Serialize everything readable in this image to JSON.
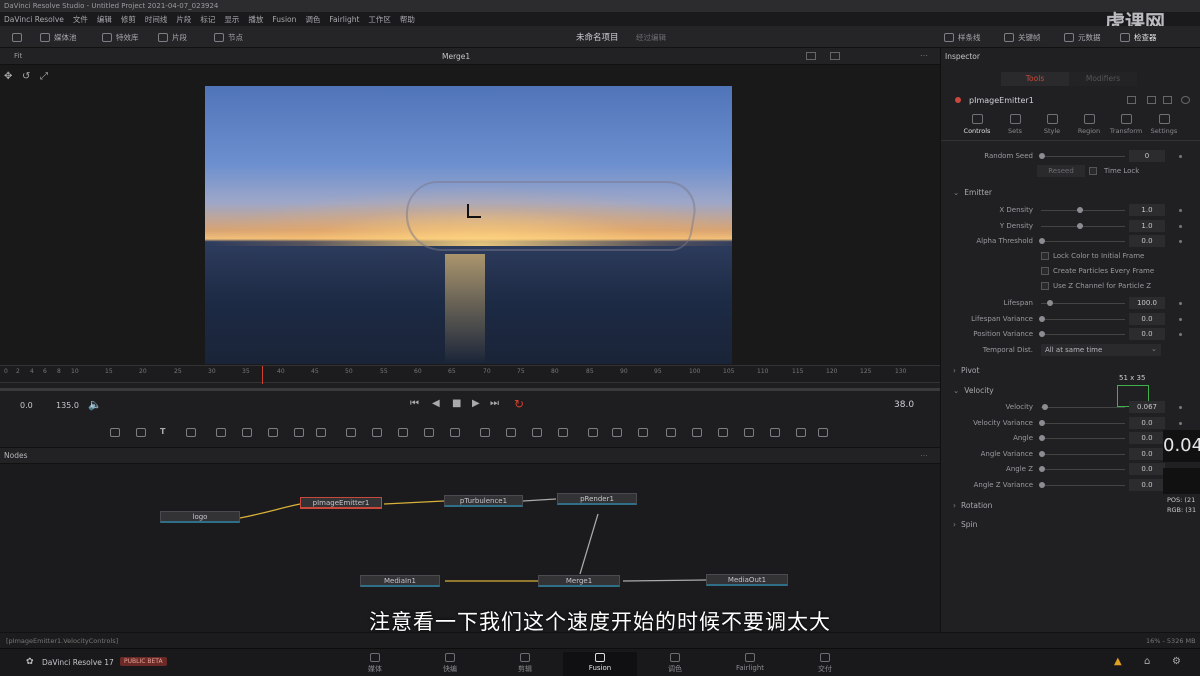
{
  "window_title": "DaVinci Resolve Studio - Untitled Project 2021-04-07_023924",
  "watermark": "虎课网",
  "menu": [
    "DaVinci Resolve",
    "文件",
    "编辑",
    "修剪",
    "时间线",
    "片段",
    "标记",
    "显示",
    "播放",
    "Fusion",
    "调色",
    "Fairlight",
    "工作区",
    "帮助"
  ],
  "toolbar": {
    "media_pool": "媒体池",
    "effects": "特效库",
    "clips": "片段",
    "nodes": "节点",
    "project_name": "未命名项目",
    "edited": "经过编辑",
    "spline": "样条线",
    "keyframes": "关键帧",
    "metadata": "元数据",
    "inspector": "检查器"
  },
  "viewer": {
    "title": "Merge1",
    "fit": "Fit"
  },
  "timeline": {
    "ticks": [
      "0",
      "2",
      "4",
      "6",
      "8",
      "10",
      "15",
      "20",
      "25",
      "30",
      "35",
      "40",
      "45",
      "50",
      "55",
      "60",
      "65",
      "70",
      "75",
      "80",
      "85",
      "90",
      "95",
      "100",
      "105",
      "110",
      "115",
      "120",
      "125",
      "130"
    ],
    "start": "0.0",
    "end": "135.0",
    "current_frame": "38.0"
  },
  "nodes_panel": {
    "title": "Nodes",
    "nodes": [
      "logo",
      "pImageEmitter1",
      "pTurbulence1",
      "pRender1",
      "MediaIn1",
      "Merge1",
      "MediaOut1"
    ]
  },
  "inspector": {
    "title": "Inspector",
    "top_tabs": [
      "Tools",
      "Modifiers"
    ],
    "tool_name": "pImageEmitter1",
    "tabs": [
      "Controls",
      "Sets",
      "Style",
      "Region",
      "Transform",
      "Settings"
    ],
    "random_seed": {
      "label": "Random Seed",
      "value": "0"
    },
    "reseed": "Reseed",
    "time_lock": "Time Lock",
    "emitter_section": "Emitter",
    "emitter_rows": [
      {
        "label": "X Density",
        "value": "1.0",
        "pos": 0.45
      },
      {
        "label": "Y Density",
        "value": "1.0",
        "pos": 0.45
      },
      {
        "label": "Alpha Threshold",
        "value": "0.0",
        "pos": 0.0
      }
    ],
    "checkboxes": [
      "Lock Color to Initial Frame",
      "Create Particles Every Frame",
      "Use Z Channel for Particle Z"
    ],
    "lifespan_rows": [
      {
        "label": "Lifespan",
        "value": "100.0",
        "pos": 0.1
      },
      {
        "label": "Lifespan Variance",
        "value": "0.0",
        "pos": 0.0
      },
      {
        "label": "Position Variance",
        "value": "0.0",
        "pos": 0.0
      }
    ],
    "temporal_dist": {
      "label": "Temporal Dist.",
      "value": "All at same time"
    },
    "pivot_section": "Pivot",
    "velocity_section": "Velocity",
    "velocity_rows": [
      {
        "label": "Velocity",
        "value": "0.067",
        "pos": 0.03
      },
      {
        "label": "Velocity Variance",
        "value": "0.0",
        "pos": 0.0
      },
      {
        "label": "Angle",
        "value": "0.0",
        "pos": 0.0
      },
      {
        "label": "Angle Variance",
        "value": "0.0",
        "pos": 0.0
      },
      {
        "label": "Angle Z",
        "value": "0.0",
        "pos": 0.0
      },
      {
        "label": "Angle Z Variance",
        "value": "0.0",
        "pos": 0.0
      }
    ],
    "rotation_section": "Rotation",
    "spin_section": "Spin",
    "selection_size": "51 x 35",
    "zoom_readout": "0.04",
    "pos_label": "POS: (21",
    "rgb_label": "RGB: (31"
  },
  "subtitle": "注意看一下我们这个速度开始的时候不要调太大",
  "status": {
    "path": "[pImageEmitter1.VelocityControls]",
    "memory": "16% - 5326 MB"
  },
  "bottom": {
    "app_name": "DaVinci Resolve 17",
    "badge": "PUBLIC BETA",
    "pages": [
      "媒体",
      "快编",
      "剪辑",
      "Fusion",
      "调色",
      "Fairlight",
      "交付"
    ]
  },
  "colors": {
    "accent_red": "#c8493b",
    "fusion_active": "#e0e0e6",
    "node_line": "#d8b13a"
  }
}
